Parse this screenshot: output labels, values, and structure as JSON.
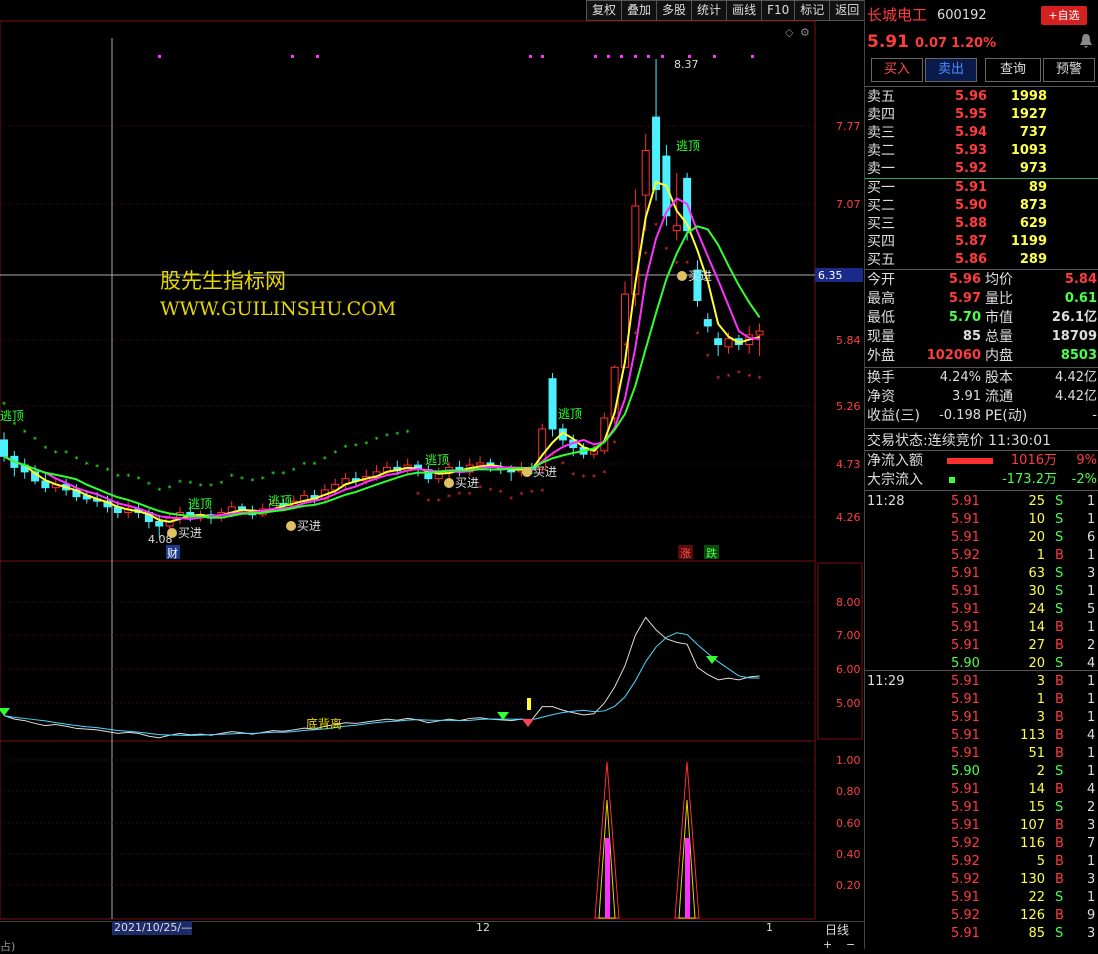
{
  "toolbar": [
    "复权",
    "叠加",
    "多股",
    "统计",
    "画线",
    "F10",
    "标记",
    "返回"
  ],
  "stock": {
    "name": "长城电工",
    "code": "600192",
    "add_label": "+自选",
    "price": "5.91",
    "change": "0.07",
    "pct": "1.20%"
  },
  "actions": [
    "买入",
    "卖出",
    "查询",
    "预警"
  ],
  "sells": [
    {
      "label": "卖五",
      "price": "5.96",
      "vol": "1998"
    },
    {
      "label": "卖四",
      "price": "5.95",
      "vol": "1927"
    },
    {
      "label": "卖三",
      "price": "5.94",
      "vol": "737"
    },
    {
      "label": "卖二",
      "price": "5.93",
      "vol": "1093"
    },
    {
      "label": "卖一",
      "price": "5.92",
      "vol": "973"
    }
  ],
  "buys": [
    {
      "label": "买一",
      "price": "5.91",
      "vol": "89"
    },
    {
      "label": "买二",
      "price": "5.90",
      "vol": "873"
    },
    {
      "label": "买三",
      "price": "5.88",
      "vol": "629"
    },
    {
      "label": "买四",
      "price": "5.87",
      "vol": "1199"
    },
    {
      "label": "买五",
      "price": "5.86",
      "vol": "289"
    }
  ],
  "stats": [
    {
      "l1": "今开",
      "v1": "5.96",
      "c1": "red",
      "l2": "均价",
      "v2": "5.84",
      "c2": "red"
    },
    {
      "l1": "最高",
      "v1": "5.97",
      "c1": "red",
      "l2": "量比",
      "v2": "0.61",
      "c2": "grn"
    },
    {
      "l1": "最低",
      "v1": "5.70",
      "c1": "grn",
      "l2": "市值",
      "v2": "26.1亿",
      "c2": "wht"
    },
    {
      "l1": "现量",
      "v1": "85",
      "c1": "wht",
      "l2": "总量",
      "v2": "18709",
      "c2": "wht"
    },
    {
      "l1": "外盘",
      "v1": "102060",
      "c1": "red",
      "l2": "内盘",
      "v2": "8503",
      "c2": "grn"
    }
  ],
  "stats2": [
    {
      "l1": "换手",
      "v1": "4.24%",
      "l2": "股本",
      "v2": "4.42亿"
    },
    {
      "l1": "净资",
      "v1": "3.91",
      "l2": "流通",
      "v2": "4.42亿"
    },
    {
      "l1": "收益(三)",
      "v1": "-0.198",
      "l2": "PE(动)",
      "v2": "-"
    }
  ],
  "trade_status": {
    "label": "交易状态:",
    "value": "连续竞价",
    "time": "11:30:01"
  },
  "flow": [
    {
      "label": "净流入额",
      "value": "1016万",
      "pct": "9%",
      "color": "red"
    },
    {
      "label": "大宗流入",
      "value": "-173.2万",
      "pct": "-2%",
      "color": "grn"
    }
  ],
  "ticks1": {
    "time": "11:28",
    "rows": [
      [
        "5.91",
        "25",
        "S",
        "1"
      ],
      [
        "5.91",
        "10",
        "S",
        "1"
      ],
      [
        "5.91",
        "20",
        "S",
        "6"
      ],
      [
        "5.92",
        "1",
        "B",
        "1"
      ],
      [
        "5.91",
        "63",
        "S",
        "3"
      ],
      [
        "5.91",
        "30",
        "S",
        "1"
      ],
      [
        "5.91",
        "24",
        "S",
        "5"
      ],
      [
        "5.91",
        "14",
        "B",
        "1"
      ],
      [
        "5.91",
        "27",
        "B",
        "2"
      ],
      [
        "5.90",
        "20",
        "S",
        "4"
      ]
    ]
  },
  "ticks2": {
    "time": "11:29",
    "rows": [
      [
        "5.91",
        "3",
        "B",
        "1"
      ],
      [
        "5.91",
        "1",
        "B",
        "1"
      ],
      [
        "5.91",
        "3",
        "B",
        "1"
      ],
      [
        "5.91",
        "113",
        "B",
        "4"
      ],
      [
        "5.91",
        "51",
        "B",
        "1"
      ],
      [
        "5.90",
        "2",
        "S",
        "1"
      ],
      [
        "5.91",
        "14",
        "B",
        "4"
      ],
      [
        "5.91",
        "15",
        "S",
        "2"
      ],
      [
        "5.91",
        "107",
        "B",
        "3"
      ],
      [
        "5.92",
        "116",
        "B",
        "7"
      ],
      [
        "5.92",
        "5",
        "B",
        "1"
      ],
      [
        "5.92",
        "130",
        "B",
        "3"
      ],
      [
        "5.91",
        "22",
        "S",
        "1"
      ],
      [
        "5.92",
        "126",
        "B",
        "9"
      ],
      [
        "5.91",
        "85",
        "S",
        "3"
      ]
    ]
  },
  "watermark": {
    "line1": "股先生指标网",
    "line2": "WWW.GUILINSHU.COM"
  },
  "chart_data": {
    "type": "candlestick",
    "price_axis": [
      "7.77",
      "7.07",
      "6.35",
      "5.84",
      "5.26",
      "4.73",
      "4.26"
    ],
    "crosshair_price": "6.35",
    "annotations": {
      "high": "8.37",
      "low": "4.08",
      "escape": "逃顶",
      "buy": "买进",
      "finance": "财",
      "limit_up": "涨",
      "limit_down": "跌",
      "divergence": "底背离"
    },
    "osc_axis": [
      "8.00",
      "7.00",
      "6.00",
      "5.00"
    ],
    "prob_axis": [
      "1.00",
      "0.80",
      "0.60",
      "0.40",
      "0.20"
    ],
    "date_labels": [
      "2021/10/25/—",
      "12",
      "1"
    ],
    "period": "日线",
    "candles": [
      [
        4.95,
        4.8,
        5.02,
        4.75
      ],
      [
        4.8,
        4.7,
        4.85,
        4.62
      ],
      [
        4.72,
        4.66,
        4.78,
        4.6
      ],
      [
        4.66,
        4.58,
        4.72,
        4.55
      ],
      [
        4.58,
        4.52,
        4.64,
        4.48
      ],
      [
        4.52,
        4.55,
        4.6,
        4.48
      ],
      [
        4.55,
        4.5,
        4.6,
        4.45
      ],
      [
        4.5,
        4.44,
        4.55,
        4.4
      ],
      [
        4.45,
        4.42,
        4.5,
        4.38
      ],
      [
        4.42,
        4.4,
        4.48,
        4.35
      ],
      [
        4.4,
        4.35,
        4.45,
        4.3
      ],
      [
        4.35,
        4.3,
        4.4,
        4.25
      ],
      [
        4.3,
        4.33,
        4.4,
        4.25
      ],
      [
        4.33,
        4.3,
        4.38,
        4.25
      ],
      [
        4.3,
        4.22,
        4.33,
        4.16
      ],
      [
        4.22,
        4.18,
        4.28,
        4.08
      ],
      [
        4.18,
        4.25,
        4.3,
        4.15
      ],
      [
        4.25,
        4.3,
        4.35,
        4.2
      ],
      [
        4.3,
        4.26,
        4.34,
        4.22
      ],
      [
        4.26,
        4.28,
        4.32,
        4.22
      ],
      [
        4.28,
        4.25,
        4.32,
        4.2
      ],
      [
        4.25,
        4.3,
        4.34,
        4.22
      ],
      [
        4.3,
        4.35,
        4.4,
        4.26
      ],
      [
        4.35,
        4.32,
        4.38,
        4.28
      ],
      [
        4.32,
        4.28,
        4.36,
        4.24
      ],
      [
        4.28,
        4.33,
        4.38,
        4.26
      ],
      [
        4.33,
        4.38,
        4.42,
        4.3
      ],
      [
        4.38,
        4.36,
        4.42,
        4.32
      ],
      [
        4.36,
        4.4,
        4.45,
        4.33
      ],
      [
        4.4,
        4.45,
        4.5,
        4.38
      ],
      [
        4.45,
        4.42,
        4.5,
        4.38
      ],
      [
        4.42,
        4.5,
        4.55,
        4.4
      ],
      [
        4.5,
        4.55,
        4.6,
        4.46
      ],
      [
        4.55,
        4.6,
        4.65,
        4.5
      ],
      [
        4.6,
        4.58,
        4.66,
        4.54
      ],
      [
        4.58,
        4.62,
        4.68,
        4.55
      ],
      [
        4.62,
        4.66,
        4.72,
        4.58
      ],
      [
        4.66,
        4.7,
        4.75,
        4.62
      ],
      [
        4.7,
        4.67,
        4.76,
        4.63
      ],
      [
        4.67,
        4.72,
        4.78,
        4.64
      ],
      [
        4.72,
        4.68,
        4.76,
        4.62
      ],
      [
        4.68,
        4.6,
        4.72,
        4.56
      ],
      [
        4.6,
        4.65,
        4.7,
        4.56
      ],
      [
        4.65,
        4.7,
        4.75,
        4.6
      ],
      [
        4.7,
        4.66,
        4.76,
        4.62
      ],
      [
        4.66,
        4.72,
        4.78,
        4.62
      ],
      [
        4.72,
        4.74,
        4.8,
        4.68
      ],
      [
        4.74,
        4.7,
        4.78,
        4.66
      ],
      [
        4.7,
        4.68,
        4.75,
        4.64
      ],
      [
        4.68,
        4.66,
        4.72,
        4.58
      ],
      [
        4.66,
        4.7,
        4.75,
        4.62
      ],
      [
        4.7,
        4.68,
        4.74,
        4.64
      ],
      [
        4.68,
        5.05,
        5.1,
        4.65
      ],
      [
        5.5,
        5.05,
        5.55,
        4.98
      ],
      [
        5.05,
        4.95,
        5.1,
        4.9
      ],
      [
        4.95,
        4.88,
        5.0,
        4.8
      ],
      [
        4.88,
        4.82,
        4.92,
        4.78
      ],
      [
        4.82,
        4.85,
        4.9,
        4.78
      ],
      [
        4.85,
        5.15,
        5.2,
        4.82
      ],
      [
        5.15,
        5.6,
        5.62,
        5.1
      ],
      [
        5.6,
        6.2,
        6.3,
        6.0
      ],
      [
        6.2,
        7.05,
        7.2,
        6.1
      ],
      [
        7.15,
        7.55,
        7.7,
        6.8
      ],
      [
        7.85,
        7.2,
        8.37,
        7.1
      ],
      [
        7.5,
        6.95,
        7.6,
        6.85
      ],
      [
        6.8,
        6.85,
        7.35,
        6.7
      ],
      [
        7.3,
        6.8,
        7.35,
        6.7
      ],
      [
        6.4,
        6.15,
        6.5,
        6.1
      ],
      [
        6.0,
        5.95,
        6.05,
        5.9
      ],
      [
        5.85,
        5.8,
        5.9,
        5.7
      ],
      [
        5.78,
        5.85,
        5.9,
        5.72
      ],
      [
        5.85,
        5.8,
        5.88,
        5.75
      ],
      [
        5.8,
        5.88,
        5.95,
        5.72
      ],
      [
        5.88,
        5.91,
        5.97,
        5.7
      ]
    ]
  }
}
